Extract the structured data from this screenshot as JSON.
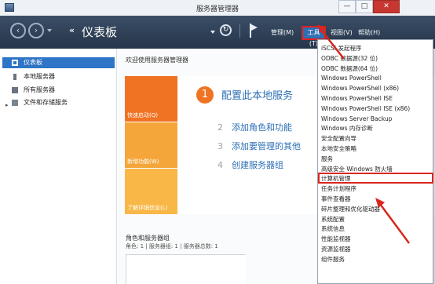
{
  "window": {
    "title": "服务器管理器",
    "minimize": "—",
    "maximize": "□",
    "close": "✕"
  },
  "header": {
    "breadcrumb_arrows": "‹‹",
    "breadcrumb": "仪表板",
    "refresh_glyph": "↻",
    "menu": {
      "manage": "管理(M)",
      "tools": "工具(T)",
      "view": "视图(V)",
      "help": "帮助(H)"
    }
  },
  "sidebar": {
    "items": [
      {
        "label": "仪表板",
        "icon": "dashboard-icon",
        "active": true
      },
      {
        "label": "本地服务器",
        "icon": "server-icon"
      },
      {
        "label": "所有服务器",
        "icon": "servers-icon"
      },
      {
        "label": "文件和存储服务",
        "icon": "folder-icon",
        "expand": "▸"
      }
    ]
  },
  "main": {
    "welcome": "欢迎使用服务器管理器",
    "tiles": [
      "快速启动(Q)",
      "新增功能(W)",
      "了解详细信息(L)"
    ],
    "steps": [
      {
        "num": "1",
        "text": "配置此本地服务"
      },
      {
        "num": "2",
        "text": "添加角色和功能"
      },
      {
        "num": "3",
        "text": "添加要管理的其他"
      },
      {
        "num": "4",
        "text": "创建服务器组"
      }
    ],
    "roles_title": "角色和服务器组",
    "roles_sub": "角色: 1 | 服务器组: 1 | 服务器总数: 1"
  },
  "tools_menu": {
    "items": [
      "iSCSI 发起程序",
      "ODBC 数据源(32 位)",
      "ODBC 数据源(64 位)",
      "Windows PowerShell",
      "Windows PowerShell (x86)",
      "Windows PowerShell ISE",
      "Windows PowerShell ISE (x86)",
      "Windows Server Backup",
      "Windows 内存诊断",
      "安全配置向导",
      "本地安全策略",
      "服务",
      "高级安全 Windows 防火墙",
      "计算机管理",
      "任务计划程序",
      "事件查看器",
      "碎片整理和优化驱动器",
      "系统配置",
      "系统信息",
      "性能监视器",
      "资源监视器",
      "组件服务"
    ],
    "highlighted_index": 13
  },
  "colors": {
    "accent": "#2f75c7",
    "annotation_red": "#d9261f",
    "tile_orange": "#f07323",
    "tile_amber": "#f5a63b"
  }
}
